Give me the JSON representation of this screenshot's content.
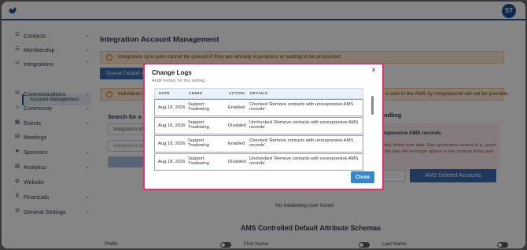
{
  "app": {
    "avatar_initials": "ST",
    "accent": "#1e4f9c"
  },
  "sidebar": {
    "items": [
      {
        "label": "Contacts",
        "icon": "contacts-icon",
        "chevron": "down"
      },
      {
        "label": "Membership",
        "icon": "membership-icon",
        "chevron": "down"
      },
      {
        "label": "Integrations",
        "icon": "integrations-icon",
        "chevron": "up"
      },
      {
        "label": "Communications",
        "icon": "communications-icon",
        "chevron": "down"
      },
      {
        "label": "Community",
        "icon": "community-icon",
        "chevron": "down"
      },
      {
        "label": "Events",
        "icon": "events-icon",
        "chevron": "down"
      },
      {
        "label": "Meetings",
        "icon": "meetings-icon",
        "chevron": ""
      },
      {
        "label": "Sponsors",
        "icon": "sponsors-icon",
        "chevron": "down"
      },
      {
        "label": "Analytics",
        "icon": "analytics-icon",
        "chevron": "down"
      },
      {
        "label": "Website",
        "icon": "website-icon",
        "chevron": ""
      },
      {
        "label": "Financials",
        "icon": "financials-icon",
        "chevron": "down"
      },
      {
        "label": "General Settings",
        "icon": "settings-icon",
        "chevron": "down"
      }
    ],
    "sub_item": "Account Management"
  },
  "main": {
    "title": "Integration Account Management",
    "warning1": "Integration sync jobs cannot be queued if they are already in progress or waiting to be processed",
    "queue_button": "Queue Default M",
    "warning2_left": "Individual Inte",
    "warning2_right": "s user in the AMS by integrationId will not be possible.",
    "search_label": "Search for a us",
    "input1_placeholder": "Integration Id",
    "input2_placeholder": "Integration Id",
    "handling_heading": "andling",
    "red_box_title": "esponsive AMS records",
    "red_box_text1": "ently delete user data. User-generated content (e.g., posts,",
    "red_box_text2": ", the user will no longer appear in the contacts listing and",
    "ams_deleted_button": "AMS Deleted Accounts",
    "no_user_text": "No tradewing user found",
    "schema_heading": "AMS Controlled Default Attribute Schemas",
    "schema_fields": [
      "Prefix",
      "First Name",
      "Last Name"
    ]
  },
  "modal": {
    "title": "Change Logs",
    "subtitle": "Audit history for this setting.",
    "close_x": "×",
    "columns": [
      "DATE",
      "ADMIN",
      "ACTION",
      "DETAILS"
    ],
    "rows": [
      {
        "date": "Aug 18, 2026",
        "admin": "Support Tradewing",
        "action": "Enabled",
        "details": "Checked 'Remove contacts with unresponsive AMS records'."
      },
      {
        "date": "Aug 18, 2026",
        "admin": "Support Tradewing",
        "action": "Disabled",
        "details": "Unchecked 'Remove contacts with unresponsive AMS records'."
      },
      {
        "date": "Aug 18, 2026",
        "admin": "Support Tradewing",
        "action": "Enabled",
        "details": "Checked 'Remove contacts with unresponsive AMS records'."
      },
      {
        "date": "Aug 18, 2026",
        "admin": "Support Tradewing",
        "action": "Disabled",
        "details": "Unchecked 'Remove contacts with unresponsive AMS records'."
      }
    ],
    "close_button": "Close"
  }
}
